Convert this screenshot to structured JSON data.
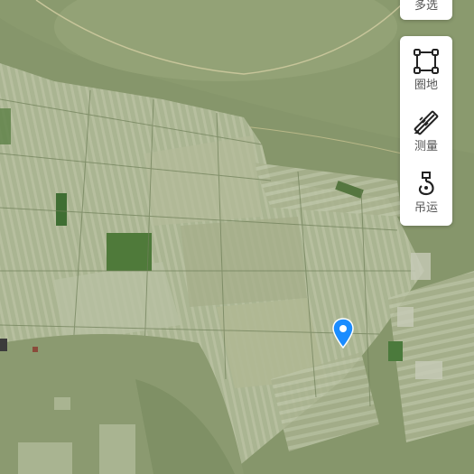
{
  "toolbar": {
    "multi_select_label": "多选",
    "items": [
      {
        "label": "圈地",
        "icon": "square-region-icon"
      },
      {
        "label": "测量",
        "icon": "ruler-pencil-icon"
      },
      {
        "label": "吊运",
        "icon": "crane-hook-icon"
      }
    ]
  },
  "colors": {
    "accent": "#1a8cff",
    "panel_bg": "#ffffff",
    "label_text": "#555555",
    "icon_stroke": "#222222"
  }
}
